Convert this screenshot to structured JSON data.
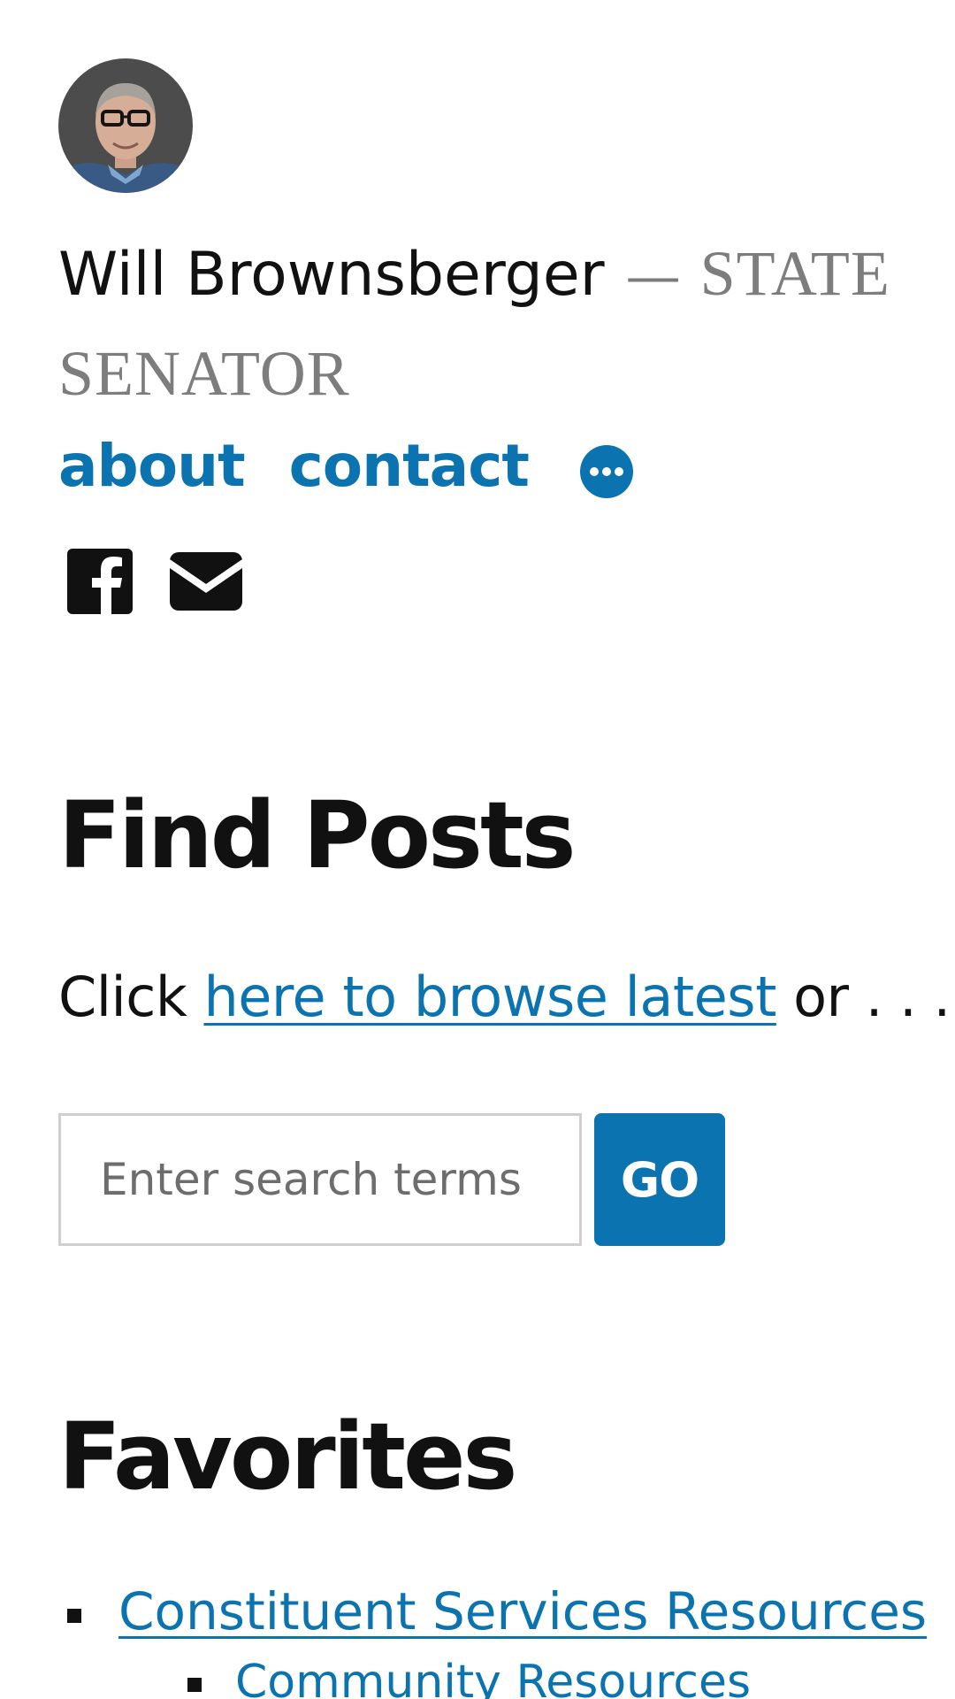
{
  "header": {
    "avatar_alt": "Will Brownsberger",
    "site_name": "Will Brownsberger",
    "separator": "—",
    "tagline": "STATE SENATOR"
  },
  "nav": {
    "items": [
      {
        "label": "about"
      },
      {
        "label": "contact"
      }
    ],
    "more_icon": "more-horizontal-icon",
    "accent_color": "#0b74b0"
  },
  "social": {
    "icons": [
      "facebook-icon",
      "mail-icon"
    ]
  },
  "find_posts": {
    "title": "Find Posts",
    "browse_prefix": "Click ",
    "browse_link": "here to browse latest",
    "browse_suffix": " or . . .",
    "search_placeholder": "Enter search terms",
    "go_label": "GO"
  },
  "favorites": {
    "title": "Favorites",
    "items": [
      {
        "label": "Constituent Services Resources",
        "children": [
          {
            "label": "Community Resources"
          }
        ]
      }
    ]
  }
}
